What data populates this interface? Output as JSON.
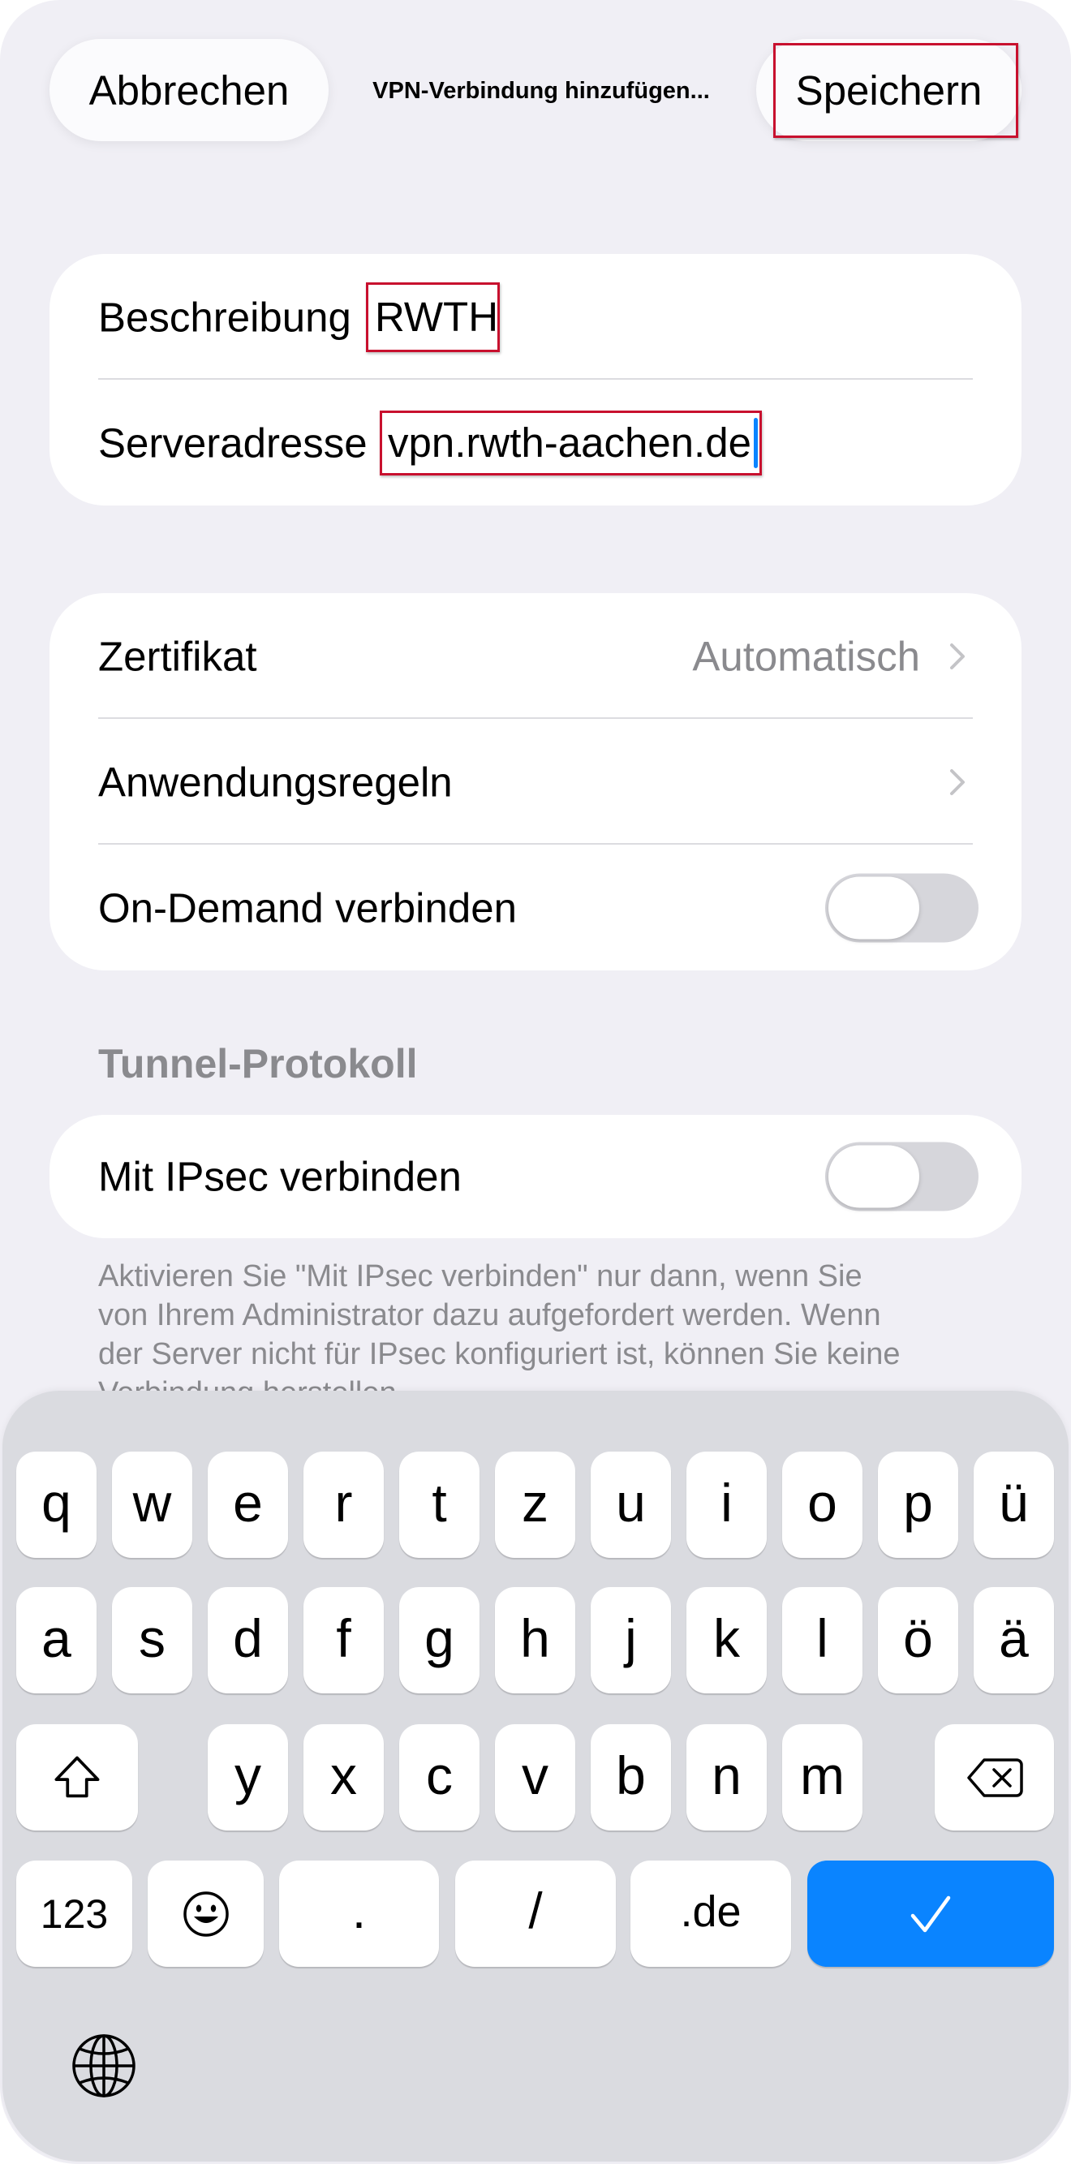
{
  "header": {
    "cancel_label": "Abbrechen",
    "title": "VPN-Verbindung hinzufügen...",
    "save_label": "Speichern"
  },
  "connection": {
    "description_label": "Beschreibung",
    "description_value": "RWTH",
    "server_label": "Serveradresse",
    "server_value": "vpn.rwth-aachen.de"
  },
  "settings": {
    "certificate_label": "Zertifikat",
    "certificate_value": "Automatisch",
    "rules_label": "Anwendungsregeln",
    "on_demand_label": "On-Demand verbinden",
    "on_demand_enabled": false
  },
  "tunnel": {
    "section_title": "Tunnel-Protokoll",
    "ipsec_label": "Mit IPsec verbinden",
    "ipsec_enabled": false,
    "footer_lines": [
      "Aktivieren Sie \"Mit IPsec verbinden\" nur dann, wenn Sie",
      "von Ihrem Administrator dazu aufgefordert werden. Wenn",
      "der Server nicht für IPsec konfiguriert ist, können Sie keine",
      "Verbindung herstellen."
    ]
  },
  "keyboard": {
    "row1": [
      "q",
      "w",
      "e",
      "r",
      "t",
      "z",
      "u",
      "i",
      "o",
      "p",
      "ü"
    ],
    "row2": [
      "a",
      "s",
      "d",
      "f",
      "g",
      "h",
      "j",
      "k",
      "l",
      "ö",
      "ä"
    ],
    "row3": [
      "y",
      "x",
      "c",
      "v",
      "b",
      "n",
      "m"
    ],
    "numbers_label": "123",
    "period_label": ".",
    "slash_label": "/",
    "domain_label": ".de",
    "icons": {
      "shift": "shift-icon",
      "delete": "delete-icon",
      "emoji": "emoji-icon",
      "return": "checkmark-icon",
      "globe": "globe-icon",
      "chevron": "chevron-right-icon"
    }
  },
  "colors": {
    "background": "#f0eff5",
    "accent": "#0a84ff",
    "secondary_text": "#8a8a8e",
    "keyboard": "#dadbe0",
    "annotation": "#c8102e"
  }
}
